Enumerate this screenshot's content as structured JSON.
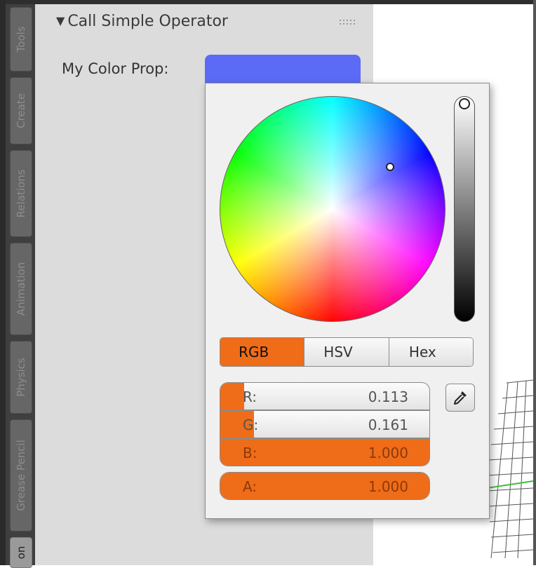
{
  "sidebar_tabs": [
    "Tools",
    "Create",
    "Relations",
    "Animation",
    "Physics",
    "Grease Pencil",
    "on"
  ],
  "panel": {
    "title": "Call Simple Operator",
    "property_label": "My Color Prop:",
    "swatch_color": "#5b6bf6"
  },
  "picker": {
    "modes": [
      "RGB",
      "HSV",
      "Hex"
    ],
    "active_mode": "RGB",
    "channels": [
      {
        "label": "R:",
        "value": "0.113",
        "level": 0.113
      },
      {
        "label": "G:",
        "value": "0.161",
        "level": 0.161
      },
      {
        "label": "B:",
        "value": "1.000",
        "level": 1.0
      },
      {
        "label": "A:",
        "value": "1.000",
        "level": 1.0
      }
    ],
    "eyedropper_icon": "eyedropper-icon",
    "accent_color": "#ef6c18"
  }
}
